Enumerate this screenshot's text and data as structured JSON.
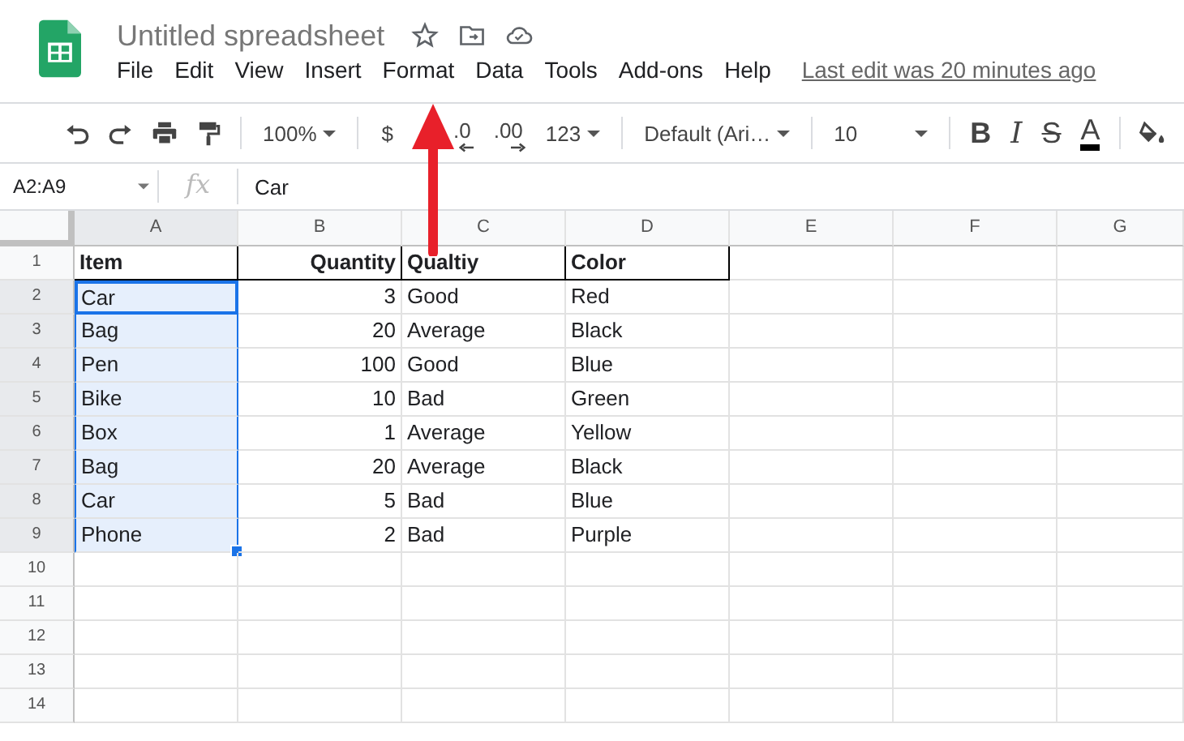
{
  "document": {
    "title": "Untitled spreadsheet",
    "last_edit": "Last edit was 20 minutes ago"
  },
  "menu": [
    "File",
    "Edit",
    "View",
    "Insert",
    "Format",
    "Data",
    "Tools",
    "Add-ons",
    "Help"
  ],
  "toolbar": [
    {
      "kind": "undo"
    },
    {
      "kind": "redo"
    },
    {
      "kind": "print"
    },
    {
      "kind": "paint-format"
    },
    {
      "kind": "sep"
    },
    {
      "kind": "dropdown",
      "label": "100%"
    },
    {
      "kind": "sep"
    },
    {
      "kind": "text",
      "label": "$"
    },
    {
      "kind": "decimal-less",
      "label": ".0"
    },
    {
      "kind": "decimal-more",
      "label": ".00"
    },
    {
      "kind": "dropdown",
      "label": "123"
    },
    {
      "kind": "sep"
    },
    {
      "kind": "wide-dropdown",
      "label": "Default (Ari…"
    },
    {
      "kind": "sep"
    },
    {
      "kind": "wide-dropdown",
      "label": "10"
    },
    {
      "kind": "sep"
    },
    {
      "kind": "bold",
      "label": "B"
    },
    {
      "kind": "italic",
      "label": "I"
    },
    {
      "kind": "strike",
      "label": "S"
    },
    {
      "kind": "color",
      "label": "A"
    },
    {
      "kind": "sep"
    },
    {
      "kind": "fill"
    }
  ],
  "formula_bar": {
    "name_box": "A2:A9",
    "fx": "fx",
    "value": "Car"
  },
  "columns": [
    {
      "label": "A",
      "selected": true,
      "right_aligned": false
    },
    {
      "label": "B",
      "selected": false,
      "right_aligned": true
    },
    {
      "label": "C",
      "selected": false,
      "right_aligned": false
    },
    {
      "label": "D",
      "selected": false,
      "right_aligned": false
    },
    {
      "label": "E",
      "selected": false,
      "right_aligned": false
    },
    {
      "label": "F",
      "selected": false,
      "right_aligned": false
    },
    {
      "label": "G",
      "selected": false,
      "right_aligned": false
    }
  ],
  "rows": [
    {
      "number": "1",
      "kind": "header",
      "selected": false,
      "cells": [
        "Item",
        "Quantity",
        "Qualtiy",
        "Color"
      ]
    },
    {
      "number": "2",
      "kind": "data",
      "selected": true,
      "cells": [
        "Car",
        "3",
        "Good",
        "Red"
      ]
    },
    {
      "number": "3",
      "kind": "data",
      "selected": true,
      "cells": [
        "Bag",
        "20",
        "Average",
        "Black"
      ]
    },
    {
      "number": "4",
      "kind": "data",
      "selected": true,
      "cells": [
        "Pen",
        "100",
        "Good",
        "Blue"
      ]
    },
    {
      "number": "5",
      "kind": "data",
      "selected": true,
      "cells": [
        "Bike",
        "10",
        "Bad",
        "Green"
      ]
    },
    {
      "number": "6",
      "kind": "data",
      "selected": true,
      "cells": [
        "Box",
        "1",
        "Average",
        "Yellow"
      ]
    },
    {
      "number": "7",
      "kind": "data",
      "selected": true,
      "cells": [
        "Bag",
        "20",
        "Average",
        "Black"
      ]
    },
    {
      "number": "8",
      "kind": "data",
      "selected": true,
      "cells": [
        "Car",
        "5",
        "Bad",
        "Blue"
      ]
    },
    {
      "number": "9",
      "kind": "data",
      "selected": true,
      "cells": [
        "Phone",
        "2",
        "Bad",
        "Purple"
      ]
    },
    {
      "number": "10",
      "kind": "data",
      "selected": false
    },
    {
      "number": "11",
      "kind": "data",
      "selected": false
    },
    {
      "number": "12",
      "kind": "data",
      "selected": false
    },
    {
      "number": "13",
      "kind": "data",
      "selected": false
    },
    {
      "number": "14",
      "kind": "data",
      "selected": false
    }
  ]
}
